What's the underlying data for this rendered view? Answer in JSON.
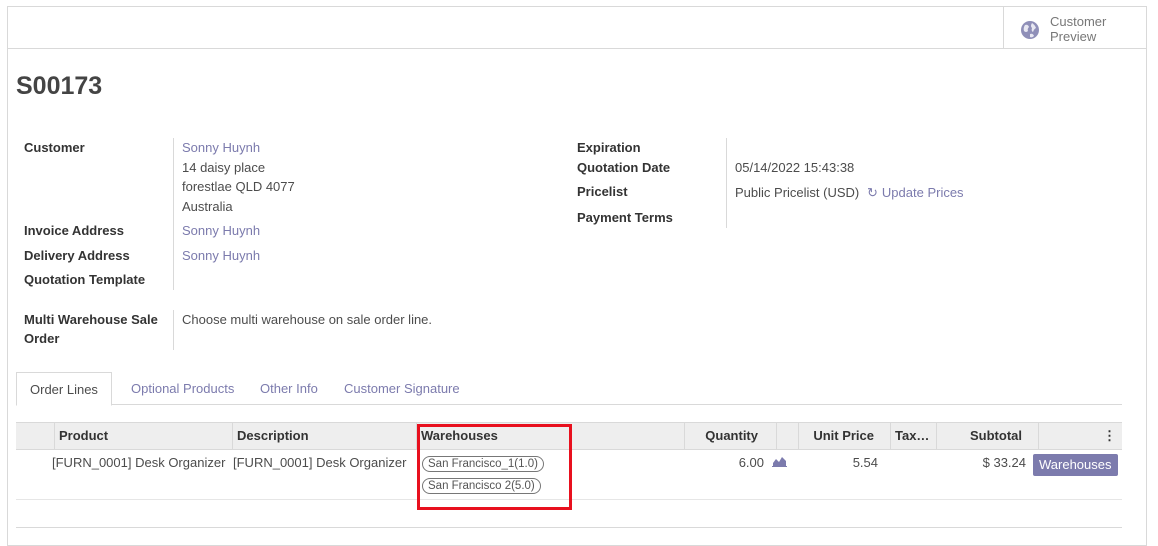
{
  "header": {
    "customer_preview": "Customer Preview",
    "globe_icon": "globe-icon"
  },
  "record": {
    "name": "S00173"
  },
  "fields_left": {
    "customer_label": "Customer",
    "customer_name": "Sonny Huynh",
    "address": [
      "14 daisy place",
      "forestlae QLD 4077",
      "Australia"
    ],
    "invoice_label": "Invoice Address",
    "invoice_value": "Sonny Huynh",
    "delivery_label": "Delivery Address",
    "delivery_value": "Sonny Huynh",
    "template_label": "Quotation Template",
    "template_value": "",
    "multi_wh_label": "Multi Warehouse Sale Order",
    "multi_wh_value": "Choose multi warehouse on sale order line."
  },
  "fields_right": {
    "expiration_label": "Expiration",
    "expiration_value": "",
    "quotation_date_label": "Quotation Date",
    "quotation_date_value": "05/14/2022 15:43:38",
    "pricelist_label": "Pricelist",
    "pricelist_value": "Public Pricelist (USD)",
    "update_prices": "Update Prices",
    "payment_terms_label": "Payment Terms",
    "payment_terms_value": ""
  },
  "tabs": [
    "Order Lines",
    "Optional Products",
    "Other Info",
    "Customer Signature"
  ],
  "table": {
    "headers": {
      "product": "Product",
      "description": "Description",
      "warehouses": "Warehouses",
      "quantity": "Quantity",
      "unit_price": "Unit Price",
      "taxes": "Tax…",
      "subtotal": "Subtotal"
    },
    "rows": [
      {
        "product": "[FURN_0001] Desk Organizer",
        "description": "[FURN_0001] Desk Organizer",
        "warehouses": [
          "San Francisco_1(1.0)",
          "San Francisco 2(5.0)"
        ],
        "quantity": "6.00",
        "unit_price": "5.54",
        "taxes": "",
        "subtotal": "$ 33.24",
        "button": "Warehouses"
      }
    ]
  },
  "colors": {
    "accent": "#7c7bad",
    "highlight": "#e8101e"
  }
}
